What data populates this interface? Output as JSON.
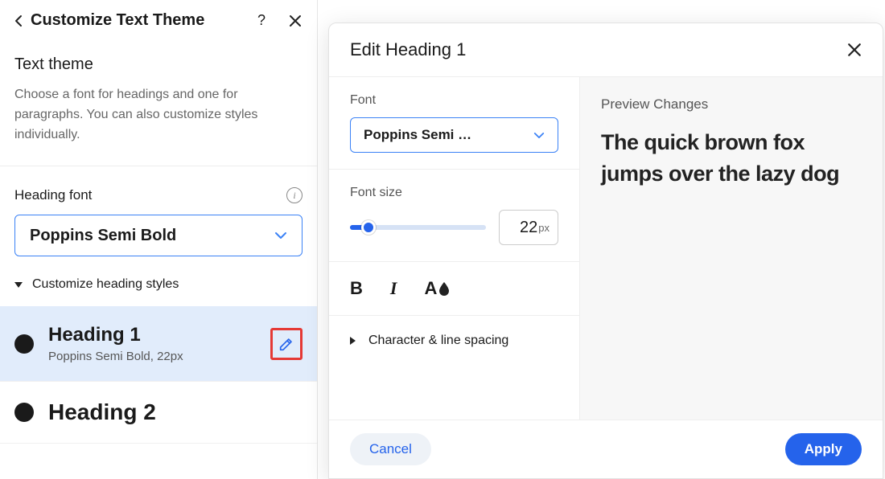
{
  "left": {
    "title": "Customize Text Theme",
    "section_title": "Text theme",
    "section_desc": "Choose a font for headings and one for paragraphs. You can also customize styles individually.",
    "heading_font_label": "Heading font",
    "heading_font_value": "Poppins Semi Bold",
    "customize_heading_styles": "Customize heading styles",
    "headings": [
      {
        "name": "Heading 1",
        "detail": "Poppins Semi Bold, 22px"
      },
      {
        "name": "Heading 2",
        "detail": ""
      }
    ]
  },
  "popover": {
    "title": "Edit Heading 1",
    "font_label": "Font",
    "font_value": "Poppins Semi …",
    "font_size_label": "Font size",
    "font_size_value": "22",
    "font_size_unit": "px",
    "spacing_label": "Character & line spacing",
    "preview_label": "Preview Changes",
    "preview_text": "The quick brown fox jumps over the lazy dog",
    "cancel": "Cancel",
    "apply": "Apply"
  }
}
